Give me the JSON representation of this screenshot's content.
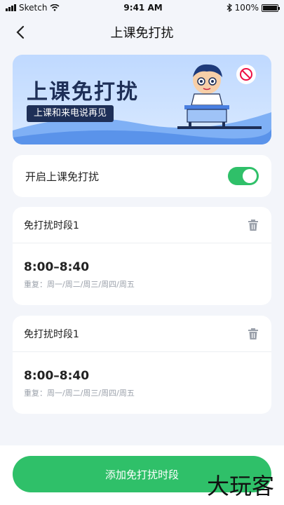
{
  "status": {
    "carrier": "Sketch",
    "time": "9:41 AM",
    "battery": "100%"
  },
  "nav": {
    "title": "上课免打扰"
  },
  "banner": {
    "headline": "上课免打扰",
    "subtitle": "上课和来电说再见"
  },
  "toggle": {
    "label": "开启上课免打扰",
    "on": true
  },
  "periods": [
    {
      "name": "免打扰时段1",
      "time": "8:00–8:40",
      "repeat": "重复：周一/周二/周三/周四/周五"
    },
    {
      "name": "免打扰时段1",
      "time": "8:00–8:40",
      "repeat": "重复：周一/周二/周三/周四/周五"
    }
  ],
  "add_button": "添加免打扰时段",
  "watermark": "大玩客",
  "colors": {
    "accent": "#2fc069",
    "banner_text": "#1e2f57"
  }
}
